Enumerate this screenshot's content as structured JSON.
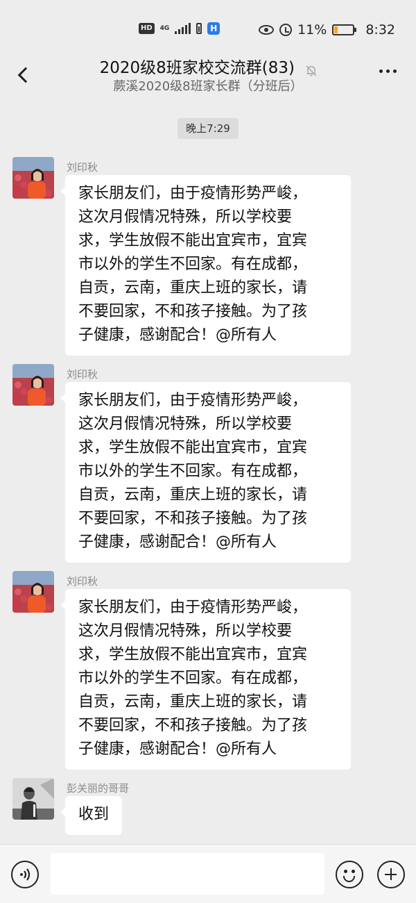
{
  "status_bar": {
    "hd": "HD",
    "network": "4G",
    "battery_percent_text": "11%",
    "battery_level": 0.11,
    "time": "8:32",
    "icons": [
      "hd-icon",
      "signal-icon",
      "sim-battery-icon",
      "app-notification-icon",
      "eye-icon",
      "alarm-icon",
      "battery-icon"
    ]
  },
  "header": {
    "title": "2020级8班家校交流群(83)",
    "subtitle": "蕨溪2020级8班家长群（分班后）",
    "icons": [
      "back-icon",
      "mute-bell-icon",
      "more-icon"
    ]
  },
  "time_divider": "晚上7:29",
  "messages": [
    {
      "sender": "刘印秋",
      "avatar": "avatar-woman-red-flowers",
      "lines": [
        "家长朋友们，由于疫情形势严峻，",
        "这次月假情况特殊，所以学校要",
        "求，学生放假不能出宜宾市，宜宾",
        "市以外的学生不回家。有在成都，",
        "自贡，云南，重庆上班的家长，请",
        "不要回家，不和孩子接触。为了孩",
        "子健康，感谢配合！@所有人"
      ]
    },
    {
      "sender": "刘印秋",
      "avatar": "avatar-woman-red-flowers",
      "lines": [
        "家长朋友们，由于疫情形势严峻，",
        "这次月假情况特殊，所以学校要",
        "求，学生放假不能出宜宾市，宜宾",
        "市以外的学生不回家。有在成都，",
        "自贡，云南，重庆上班的家长，请",
        "不要回家，不和孩子接触。为了孩",
        "子健康，感谢配合！@所有人"
      ]
    },
    {
      "sender": "刘印秋",
      "avatar": "avatar-woman-red-flowers",
      "lines": [
        "家长朋友们，由于疫情形势严峻，",
        "这次月假情况特殊，所以学校要",
        "求，学生放假不能出宜宾市，宜宾",
        "市以外的学生不回家。有在成都，",
        "自贡，云南，重庆上班的家长，请",
        "不要回家，不和孩子接触。为了孩",
        "子健康，感谢配合！@所有人"
      ]
    },
    {
      "sender": "彭关丽的哥哥",
      "avatar": "avatar-man-bw",
      "lines": [
        "收到"
      ]
    }
  ],
  "input_bar": {
    "placeholder": "",
    "icons": [
      "voice-icon",
      "emoji-icon",
      "plus-icon"
    ]
  },
  "colors": {
    "background": "#ededed",
    "bubble": "#ffffff",
    "sender_name": "#8a8a8a",
    "battery_low": "#f5a623"
  }
}
